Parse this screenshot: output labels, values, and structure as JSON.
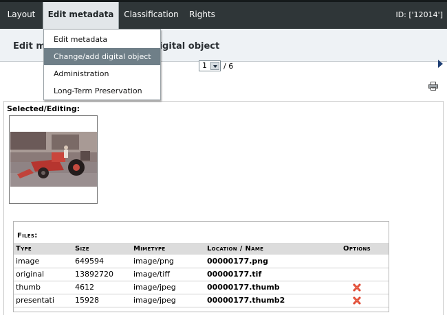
{
  "nav": {
    "tabs": [
      "Layout",
      "Edit metadata",
      "Classification",
      "Rights"
    ],
    "id_label": "ID: ['12014']"
  },
  "title_band": {
    "title": "Edit metadata: change/add digital object"
  },
  "menu": {
    "items": [
      "Edit metadata",
      "Change/add digital object",
      "Administration",
      "Long-Term Preservation"
    ],
    "active_item": "Change/add digital object"
  },
  "pager": {
    "current": "1",
    "total_label": "/ 6"
  },
  "icons": {
    "next": "next-arrow-icon",
    "print": "print-icon",
    "delete": "delete-x-icon",
    "dropdown": "chevron-down-icon"
  },
  "panel": {
    "label": "Selected/Editing:"
  },
  "files": {
    "caption": "Files:",
    "columns": [
      "Type",
      "Size",
      "Mimetype",
      "Location / Name",
      "Options"
    ],
    "rows": [
      {
        "type": "image",
        "size": "649594",
        "mimetype": "image/png",
        "location": "00000177.png",
        "deletable": false
      },
      {
        "type": "original",
        "size": "13892720",
        "mimetype": "image/tiff",
        "location": "00000177.tif",
        "deletable": false
      },
      {
        "type": "thumb",
        "size": "4612",
        "mimetype": "image/jpeg",
        "location": "00000177.thumb",
        "deletable": true
      },
      {
        "type": "presentati",
        "size": "15928",
        "mimetype": "image/jpeg",
        "location": "00000177.thumb2",
        "deletable": true
      }
    ]
  },
  "colors": {
    "topbar": "#2f3638",
    "active_tab": "#e2e6e9",
    "menu_highlight": "#6f7f88",
    "delete_icon": "#d8331e",
    "next_arrow": "#1f3f74"
  }
}
